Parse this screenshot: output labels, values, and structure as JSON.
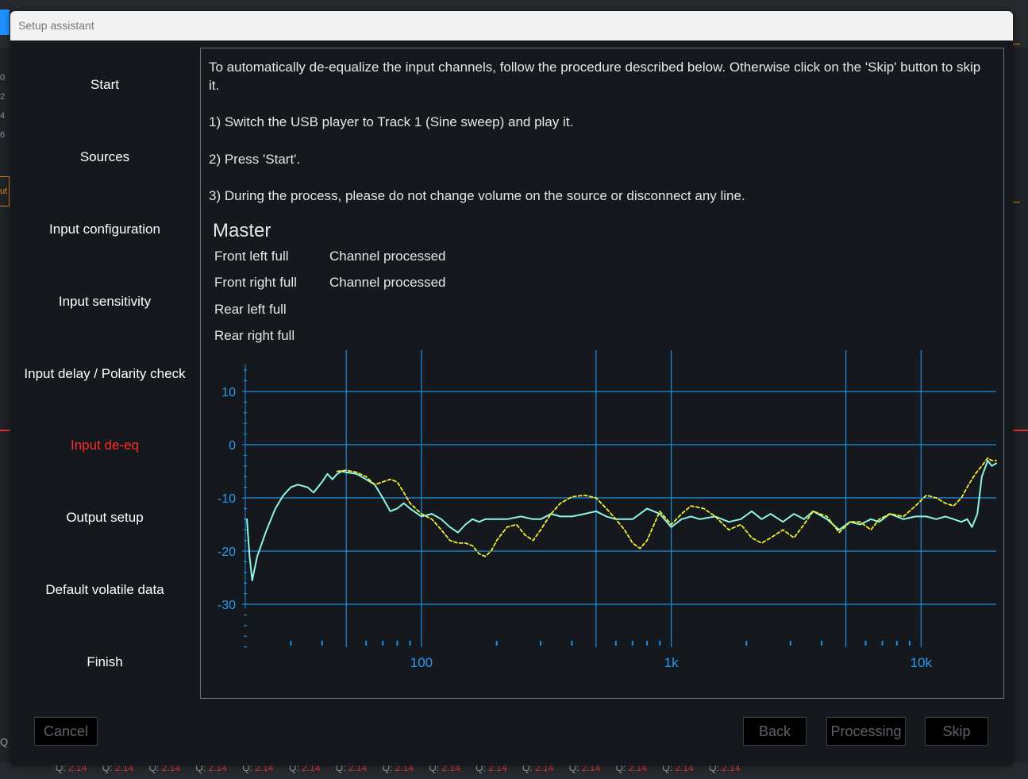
{
  "dialog": {
    "title": "Setup assistant"
  },
  "steps": [
    {
      "label": "Start"
    },
    {
      "label": "Sources"
    },
    {
      "label": "Input configuration"
    },
    {
      "label": "Input sensitivity"
    },
    {
      "label": "Input delay / Polarity check"
    },
    {
      "label": "Input de-eq",
      "active": true
    },
    {
      "label": "Output setup"
    },
    {
      "label": "Default volatile data"
    },
    {
      "label": "Finish"
    }
  ],
  "instructions": {
    "p1": "To automatically de-equalize the input channels, follow the procedure described below. Otherwise click on the 'Skip' button to skip it.",
    "p2": "1) Switch the USB player to Track 1 (Sine sweep) and play it.",
    "p3": "2) Press 'Start'.",
    "p4": "3) During the process, please do not change volume on the source or disconnect any line."
  },
  "master": {
    "title": "Master",
    "channels": [
      {
        "name": "Front left full",
        "status": "Channel processed"
      },
      {
        "name": "Front right full",
        "status": "Channel processed"
      },
      {
        "name": "Rear left full",
        "status": ""
      },
      {
        "name": "Rear right full",
        "status": ""
      }
    ]
  },
  "chart_data": {
    "type": "line",
    "x_scale": "log",
    "xlim": [
      20,
      20000
    ],
    "ylim": [
      -40,
      15
    ],
    "y_ticks": [
      10,
      0,
      -10,
      -20,
      -30
    ],
    "y_tick_labels": [
      "10",
      "0",
      "-10",
      "-20",
      "-30"
    ],
    "x_tick_labels": [
      {
        "value": 100,
        "label": "100"
      },
      {
        "value": 1000,
        "label": "1k"
      },
      {
        "value": 10000,
        "label": "10k"
      }
    ],
    "grid": true,
    "colors": {
      "grid": "#1f8fe0",
      "label": "#2a9bf0",
      "solid": "#8ff5e6",
      "dashed": "#f2ee3a"
    },
    "series": [
      {
        "style": "solid",
        "points": [
          [
            20,
            -14
          ],
          [
            20.5,
            -21
          ],
          [
            21,
            -25.5
          ],
          [
            22,
            -21
          ],
          [
            24,
            -16
          ],
          [
            26,
            -12
          ],
          [
            28,
            -9.5
          ],
          [
            30,
            -8
          ],
          [
            32,
            -7.5
          ],
          [
            35,
            -8
          ],
          [
            37,
            -9
          ],
          [
            40,
            -7
          ],
          [
            42,
            -5.5
          ],
          [
            44,
            -6.5
          ],
          [
            46,
            -5.5
          ],
          [
            48,
            -5
          ],
          [
            50,
            -5.2
          ],
          [
            55,
            -5.5
          ],
          [
            60,
            -6.5
          ],
          [
            65,
            -7.5
          ],
          [
            70,
            -10
          ],
          [
            75,
            -12.5
          ],
          [
            80,
            -12
          ],
          [
            85,
            -11
          ],
          [
            90,
            -12
          ],
          [
            100,
            -13.5
          ],
          [
            110,
            -13
          ],
          [
            120,
            -14
          ],
          [
            130,
            -15.5
          ],
          [
            140,
            -16.5
          ],
          [
            150,
            -15
          ],
          [
            160,
            -14
          ],
          [
            170,
            -14.5
          ],
          [
            180,
            -14
          ],
          [
            200,
            -14
          ],
          [
            220,
            -14
          ],
          [
            250,
            -13.5
          ],
          [
            280,
            -14
          ],
          [
            300,
            -14
          ],
          [
            330,
            -13
          ],
          [
            360,
            -13.5
          ],
          [
            400,
            -13.5
          ],
          [
            450,
            -13
          ],
          [
            500,
            -12.5
          ],
          [
            550,
            -13.5
          ],
          [
            600,
            -14
          ],
          [
            650,
            -14
          ],
          [
            700,
            -14
          ],
          [
            750,
            -13
          ],
          [
            800,
            -12
          ],
          [
            900,
            -13
          ],
          [
            1000,
            -15.5
          ],
          [
            1100,
            -14
          ],
          [
            1200,
            -13.5
          ],
          [
            1300,
            -14
          ],
          [
            1500,
            -13.5
          ],
          [
            1700,
            -14.5
          ],
          [
            1900,
            -14
          ],
          [
            2100,
            -12.5
          ],
          [
            2300,
            -14
          ],
          [
            2500,
            -13
          ],
          [
            2800,
            -14.5
          ],
          [
            3100,
            -13
          ],
          [
            3400,
            -14
          ],
          [
            3700,
            -12.5
          ],
          [
            4200,
            -14
          ],
          [
            4700,
            -16
          ],
          [
            5200,
            -14.5
          ],
          [
            5700,
            -15
          ],
          [
            6300,
            -14
          ],
          [
            6800,
            -14.5
          ],
          [
            7500,
            -13
          ],
          [
            8500,
            -14
          ],
          [
            9500,
            -13.5
          ],
          [
            10500,
            -13.5
          ],
          [
            11500,
            -14
          ],
          [
            12500,
            -13.5
          ],
          [
            13500,
            -14
          ],
          [
            14500,
            -14.5
          ],
          [
            15300,
            -14
          ],
          [
            16000,
            -15.5
          ],
          [
            16800,
            -13
          ],
          [
            17500,
            -6
          ],
          [
            18500,
            -3
          ],
          [
            19200,
            -4
          ],
          [
            20000,
            -3.5
          ]
        ]
      },
      {
        "style": "dashed",
        "points": [
          [
            46,
            -5
          ],
          [
            50,
            -4.8
          ],
          [
            55,
            -5.2
          ],
          [
            60,
            -6
          ],
          [
            65,
            -7.5
          ],
          [
            70,
            -7
          ],
          [
            75,
            -6.5
          ],
          [
            80,
            -7
          ],
          [
            85,
            -9
          ],
          [
            90,
            -11
          ],
          [
            100,
            -13
          ],
          [
            110,
            -14
          ],
          [
            120,
            -16
          ],
          [
            130,
            -18
          ],
          [
            140,
            -18.5
          ],
          [
            150,
            -18.5
          ],
          [
            160,
            -19
          ],
          [
            170,
            -20.5
          ],
          [
            180,
            -21
          ],
          [
            190,
            -20
          ],
          [
            200,
            -18
          ],
          [
            220,
            -15.5
          ],
          [
            240,
            -15
          ],
          [
            260,
            -17
          ],
          [
            280,
            -18
          ],
          [
            300,
            -16
          ],
          [
            330,
            -13
          ],
          [
            360,
            -11
          ],
          [
            400,
            -9.8
          ],
          [
            450,
            -9.5
          ],
          [
            500,
            -10
          ],
          [
            550,
            -12
          ],
          [
            600,
            -14
          ],
          [
            650,
            -16
          ],
          [
            700,
            -18.5
          ],
          [
            750,
            -19.5
          ],
          [
            800,
            -18
          ],
          [
            900,
            -12.5
          ],
          [
            1000,
            -15
          ],
          [
            1100,
            -13
          ],
          [
            1200,
            -11.5
          ],
          [
            1350,
            -12
          ],
          [
            1500,
            -13.5
          ],
          [
            1700,
            -16
          ],
          [
            1900,
            -15
          ],
          [
            2100,
            -17.5
          ],
          [
            2300,
            -18.5
          ],
          [
            2500,
            -17.5
          ],
          [
            2800,
            -16
          ],
          [
            3100,
            -17.5
          ],
          [
            3400,
            -15
          ],
          [
            3700,
            -12.5
          ],
          [
            4200,
            -13.5
          ],
          [
            4700,
            -16.5
          ],
          [
            5200,
            -14.5
          ],
          [
            5700,
            -14.5
          ],
          [
            6300,
            -16
          ],
          [
            6800,
            -14
          ],
          [
            7500,
            -13
          ],
          [
            8500,
            -13.5
          ],
          [
            9500,
            -11.5
          ],
          [
            10500,
            -9.5
          ],
          [
            11500,
            -10
          ],
          [
            12500,
            -11
          ],
          [
            13500,
            -11.5
          ],
          [
            14500,
            -10
          ],
          [
            15500,
            -7.5
          ],
          [
            16500,
            -5.5
          ],
          [
            17500,
            -4
          ],
          [
            18500,
            -2.5
          ],
          [
            19200,
            -3
          ],
          [
            20000,
            -3
          ]
        ]
      }
    ]
  },
  "buttons": {
    "cancel": "Cancel",
    "back": "Back",
    "processing": "Processing",
    "skip": "Skip"
  },
  "background": {
    "left_ticks": [
      "0",
      "2",
      "4",
      "6"
    ],
    "left_label": "ut",
    "bottom_q_label": "Q:",
    "bottom_q_values": [
      "2.14",
      "2.14",
      "2.14",
      "2.14",
      "2.14",
      "2.14",
      "2.14",
      "2.14",
      "2.14",
      "2.14",
      "2.14",
      "2.14",
      "2.14",
      "2.14",
      "2.14"
    ],
    "bottom_left_q": "Q"
  }
}
